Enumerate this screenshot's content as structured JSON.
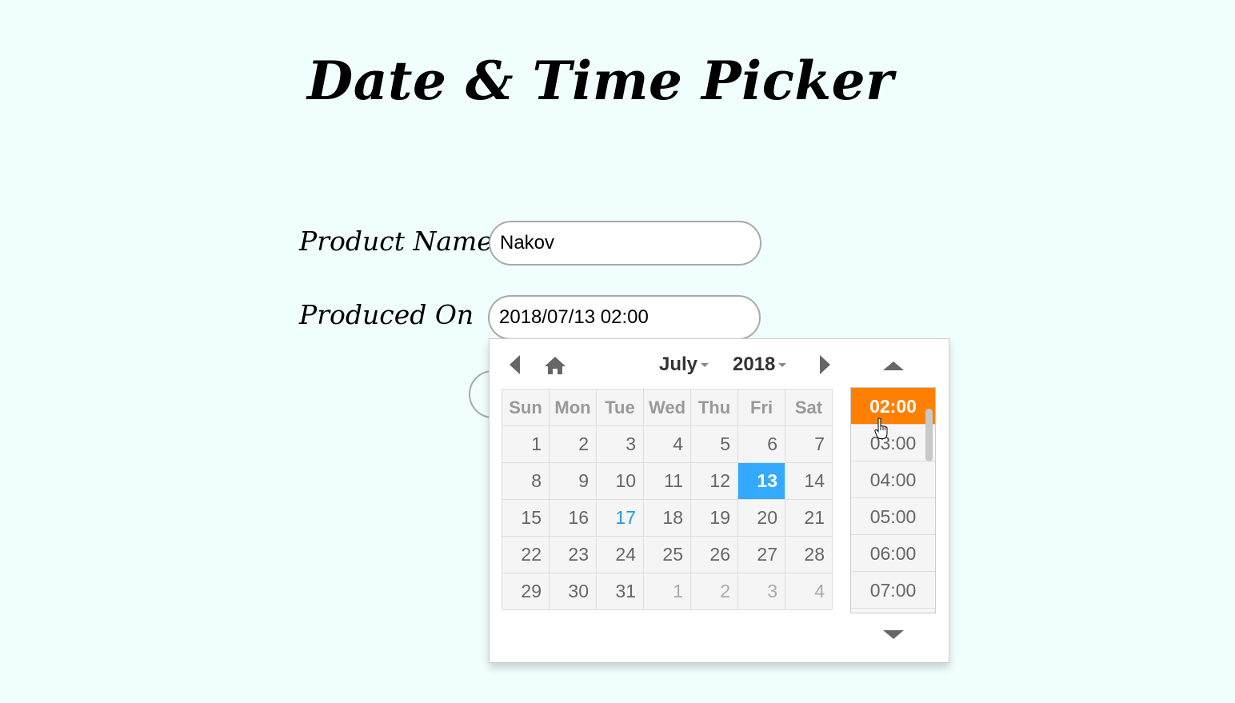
{
  "page": {
    "title": "Date & Time Picker"
  },
  "form": {
    "product_name_label": "Product Name",
    "product_name_value": "Nakov",
    "produced_on_label": "Produced On",
    "produced_on_value": "2018/07/13 02:00"
  },
  "picker": {
    "month": "July",
    "year": "2018",
    "weekdays": [
      "Sun",
      "Mon",
      "Tue",
      "Wed",
      "Thu",
      "Fri",
      "Sat"
    ],
    "weeks": [
      [
        "1",
        "2",
        "3",
        "4",
        "5",
        "6",
        "7"
      ],
      [
        "8",
        "9",
        "10",
        "11",
        "12",
        "13",
        "14"
      ],
      [
        "15",
        "16",
        "17",
        "18",
        "19",
        "20",
        "21"
      ],
      [
        "22",
        "23",
        "24",
        "25",
        "26",
        "27",
        "28"
      ],
      [
        "29",
        "30",
        "31",
        "1",
        "2",
        "3",
        "4"
      ]
    ],
    "selected_day": "13",
    "today_day": "17",
    "times": [
      "02:00",
      "03:00",
      "04:00",
      "05:00",
      "06:00",
      "07:00"
    ],
    "selected_time": "02:00",
    "colors": {
      "selected_day": "#33aaff",
      "selected_time": "#ff8000",
      "today": "#1e9be4"
    }
  }
}
